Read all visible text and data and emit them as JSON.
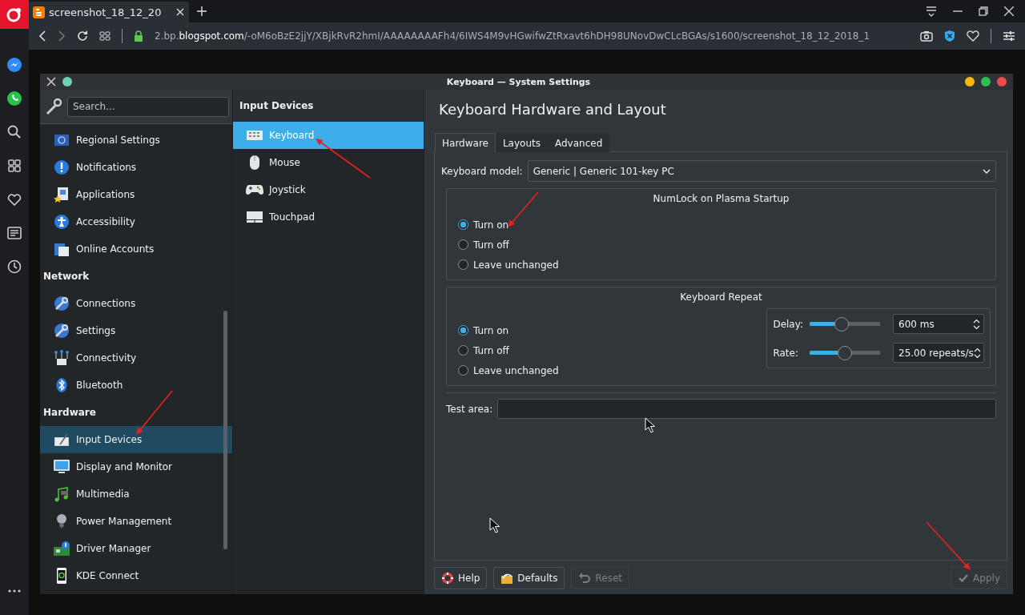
{
  "browser": {
    "tab_title": "screenshot_18_12_20",
    "url_prefix": "2.bp.",
    "url_host": "blogspot.com",
    "url_path": "/-oM6oBzE2jjY/XBjkRvR2hmI/AAAAAAAAFh4/6IWS4M9vHGwifwZtRxavt6hDH98UNovDwCLcBGAs/s1600/screenshot_18_12_2018_1"
  },
  "window": {
    "title": "Keyboard — System Settings"
  },
  "sidebar": {
    "search": {
      "placeholder": "Search..."
    },
    "items": [
      {
        "kind": "item",
        "label": "Regional Settings",
        "selected": false
      },
      {
        "kind": "item",
        "label": "Notifications",
        "selected": false
      },
      {
        "kind": "item",
        "label": "Applications",
        "selected": false
      },
      {
        "kind": "item",
        "label": "Accessibility",
        "selected": false
      },
      {
        "kind": "item",
        "label": "Online Accounts",
        "selected": false
      },
      {
        "kind": "header",
        "label": "Network"
      },
      {
        "kind": "item",
        "label": "Connections",
        "selected": false
      },
      {
        "kind": "item",
        "label": "Settings",
        "selected": false
      },
      {
        "kind": "item",
        "label": "Connectivity",
        "selected": false
      },
      {
        "kind": "item",
        "label": "Bluetooth",
        "selected": false
      },
      {
        "kind": "header",
        "label": "Hardware"
      },
      {
        "kind": "item",
        "label": "Input Devices",
        "selected": true
      },
      {
        "kind": "item",
        "label": "Display and Monitor",
        "selected": false
      },
      {
        "kind": "item",
        "label": "Multimedia",
        "selected": false
      },
      {
        "kind": "item",
        "label": "Power Management",
        "selected": false
      },
      {
        "kind": "item",
        "label": "Driver Manager",
        "selected": false
      },
      {
        "kind": "item",
        "label": "KDE Connect",
        "selected": false
      }
    ]
  },
  "devices": {
    "title": "Input Devices",
    "items": [
      {
        "label": "Keyboard",
        "selected": true
      },
      {
        "label": "Mouse",
        "selected": false
      },
      {
        "label": "Joystick",
        "selected": false
      },
      {
        "label": "Touchpad",
        "selected": false
      }
    ]
  },
  "page": {
    "heading": "Keyboard Hardware and Layout",
    "tabs": [
      {
        "label": "Hardware",
        "selected": true
      },
      {
        "label": "Layouts",
        "selected": false
      },
      {
        "label": "Advanced",
        "selected": false
      }
    ],
    "keyboard_model": {
      "label": "Keyboard model:",
      "value": "Generic | Generic 101-key PC"
    },
    "numlock": {
      "title": "NumLock on Plasma Startup",
      "options": [
        {
          "label": "Turn on",
          "selected": true
        },
        {
          "label": "Turn off",
          "selected": false
        },
        {
          "label": "Leave unchanged",
          "selected": false
        }
      ]
    },
    "repeat": {
      "title": "Keyboard Repeat",
      "options": [
        {
          "label": "Turn on",
          "selected": true
        },
        {
          "label": "Turn off",
          "selected": false
        },
        {
          "label": "Leave unchanged",
          "selected": false
        }
      ],
      "sliders": [
        {
          "label": "Delay:",
          "level": 0.45,
          "value": "600 ms"
        },
        {
          "label": "Rate:",
          "level": 0.5,
          "value": "25.00 repeats/s"
        }
      ]
    },
    "test_area": {
      "label": "Test area:"
    }
  },
  "buttons": [
    {
      "kind": "help",
      "label": "Help",
      "disabled": false
    },
    {
      "kind": "defaults",
      "label": "Defaults",
      "disabled": false
    },
    {
      "kind": "reset",
      "label": "Reset",
      "disabled": true
    },
    {
      "kind": "apply",
      "label": "Apply",
      "disabled": true
    }
  ]
}
